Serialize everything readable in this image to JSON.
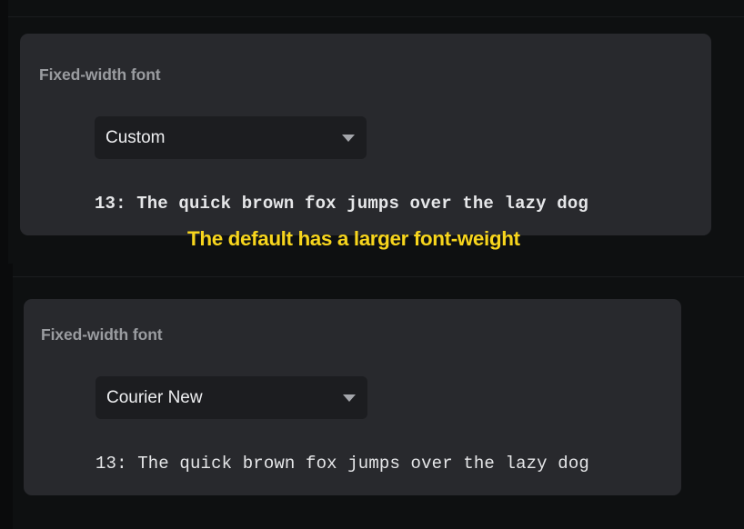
{
  "annotation": {
    "text": "The default has a larger font-weight",
    "color": "#f7d51d"
  },
  "panels": [
    {
      "label": "Fixed-width font",
      "select": {
        "value": "Custom",
        "icon": "chevron-down-icon"
      },
      "sample": "13: The quick brown fox jumps over the lazy dog",
      "sample_weight": "bold"
    },
    {
      "label": "Fixed-width font",
      "select": {
        "value": "Courier New",
        "icon": "chevron-down-icon"
      },
      "sample": "13: The quick brown fox jumps over the lazy dog",
      "sample_weight": "normal"
    }
  ],
  "colors": {
    "background": "#0e1011",
    "card": "#28292d",
    "select_bg": "#1c1d20",
    "label": "#9a9ca0",
    "text": "#eeeff1"
  }
}
